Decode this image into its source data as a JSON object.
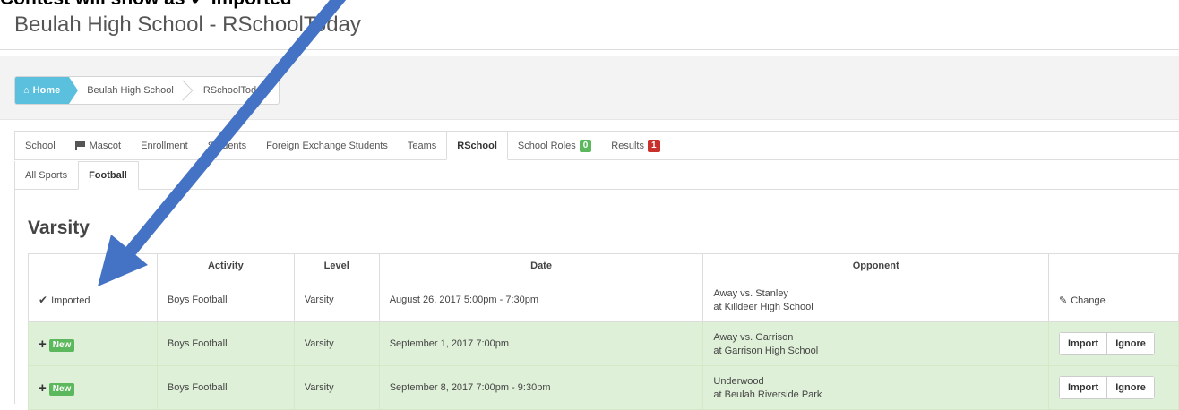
{
  "annotation": {
    "caption": "Contest will show as ✔ Imported"
  },
  "page": {
    "title": "Beulah High School - RSchoolToday"
  },
  "breadcrumb": {
    "home": "Home",
    "items": [
      "Beulah High School",
      "RSchoolToday"
    ]
  },
  "main_tabs": [
    {
      "label": "School"
    },
    {
      "label": "Mascot",
      "icon": "flag-icon"
    },
    {
      "label": "Enrollment"
    },
    {
      "label": "Students"
    },
    {
      "label": "Foreign Exchange Students"
    },
    {
      "label": "Teams"
    },
    {
      "label": "RSchool",
      "active": true
    },
    {
      "label": "School Roles",
      "badge": "0",
      "badge_color": "#5cb85c"
    },
    {
      "label": "Results",
      "badge": "1",
      "badge_color": "#c9302c"
    }
  ],
  "sub_tabs": [
    {
      "label": "All Sports"
    },
    {
      "label": "Football",
      "active": true
    }
  ],
  "section": {
    "heading": "Varsity"
  },
  "table": {
    "headers": [
      "",
      "Activity",
      "Level",
      "Date",
      "Opponent",
      ""
    ],
    "rows": [
      {
        "status": "Imported",
        "activity": "Boys Football",
        "level": "Varsity",
        "date": "August 26, 2017 5:00pm - 7:30pm",
        "opponent": "Away vs. Stanley",
        "location": "at Killdeer High School",
        "action": "Change"
      },
      {
        "status": "New",
        "activity": "Boys Football",
        "level": "Varsity",
        "date": "September 1, 2017 7:00pm",
        "opponent": "Away vs. Garrison",
        "location": "at Garrison High School",
        "import_label": "Import",
        "ignore_label": "Ignore"
      },
      {
        "status": "New",
        "activity": "Boys Football",
        "level": "Varsity",
        "date": "September 8, 2017 7:00pm - 9:30pm",
        "opponent": "Underwood",
        "location": "at Beulah Riverside Park",
        "import_label": "Import",
        "ignore_label": "Ignore"
      }
    ]
  },
  "colors": {
    "accent": "#5bc0de",
    "new_row": "#dff0d8",
    "arrow": "#4472c4"
  }
}
